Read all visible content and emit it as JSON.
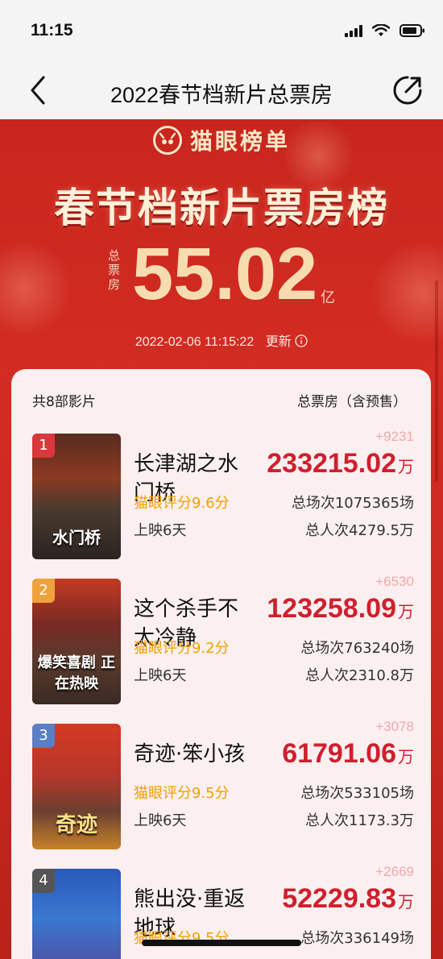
{
  "status": {
    "time": "11:15"
  },
  "nav": {
    "title": "2022春节档新片总票房"
  },
  "banner": {
    "brand": "猫眼榜单",
    "title": "春节档新片票房榜",
    "total_label": "总票房",
    "total_value": "55.02",
    "total_unit": "亿",
    "update_time": "2022-02-06  11:15:22",
    "update_label": "更新"
  },
  "list": {
    "count_label": "共8部影片",
    "column_label": "总票房（含预售）",
    "movies": [
      {
        "rank": "1",
        "name": "长津湖之水门桥",
        "rating": "猫眼评分9.6分",
        "days": "上映6天",
        "delta": "+9231",
        "box": "233215.02",
        "unit": "万",
        "shows": "总场次1075365场",
        "people": "总人次4279.5万",
        "poster_text": "水门桥"
      },
      {
        "rank": "2",
        "name": "这个杀手不太冷静",
        "rating": "猫眼评分9.2分",
        "days": "上映6天",
        "delta": "+6530",
        "box": "123258.09",
        "unit": "万",
        "shows": "总场次763240场",
        "people": "总人次2310.8万",
        "poster_text": "爆笑喜剧 正在热映"
      },
      {
        "rank": "3",
        "name": "奇迹·笨小孩",
        "rating": "猫眼评分9.5分",
        "days": "上映6天",
        "delta": "+3078",
        "box": "61791.06",
        "unit": "万",
        "shows": "总场次533105场",
        "people": "总人次1173.3万",
        "poster_text": "奇迹"
      },
      {
        "rank": "4",
        "name": "熊出没·重返地球",
        "rating": "猫眼评分9.5分",
        "days": "",
        "delta": "+2669",
        "box": "52229.83",
        "unit": "万",
        "shows": "总场次336149场",
        "people": "",
        "poster_text": ""
      }
    ]
  },
  "colors": {
    "banner_red": "#c8261d",
    "box_red": "#d11f2d",
    "rating_orange": "#f2a100",
    "rank1": "#d9373a",
    "rank2": "#f0a23a",
    "rank3": "#5b7fc4",
    "rank4": "#555"
  }
}
